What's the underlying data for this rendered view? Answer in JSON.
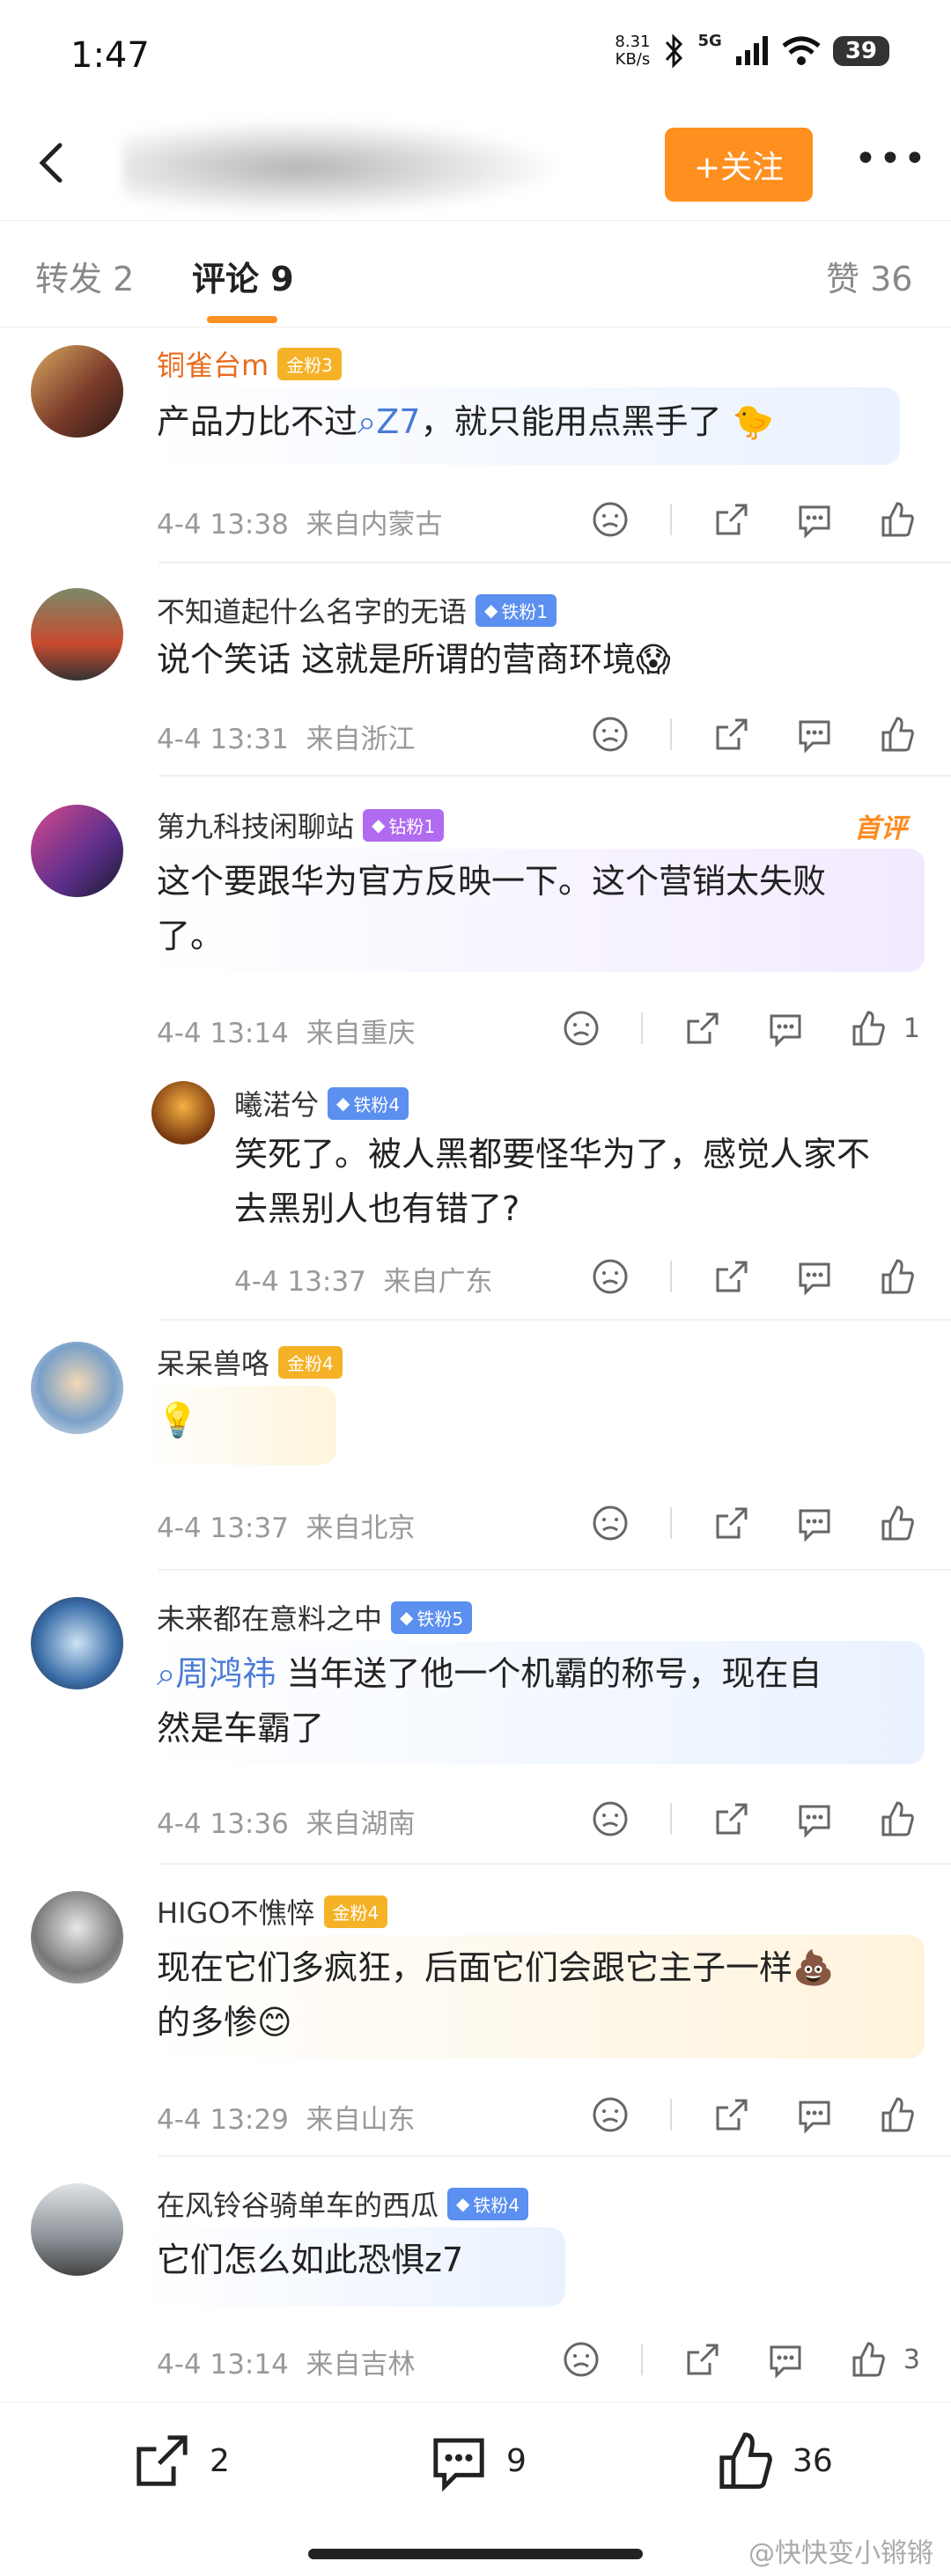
{
  "status_bar": {
    "time": "1:47",
    "net_speed_value": "8.31",
    "net_speed_unit": "KB/s",
    "network": "5G",
    "battery": "39"
  },
  "nav": {
    "follow_label": "+关注"
  },
  "tabs": {
    "repost": "转发 2",
    "comment": "评论 9",
    "like": "赞 36"
  },
  "comments": [
    {
      "name": "铜雀台m",
      "badge": "金粉3",
      "text_pre": "产品力比不过",
      "mention": "Z7",
      "text_post": "，就只能用点黑手了",
      "time": "4-4 13:38",
      "loc": "来自内蒙古"
    },
    {
      "name": "不知道起什么名字的无语",
      "badge": "铁粉1",
      "text": "说个笑话 这就是所谓的营商环境",
      "time": "4-4 13:31",
      "loc": "来自浙江"
    },
    {
      "name": "第九科技闲聊站",
      "badge": "钻粉1",
      "tag": "首评",
      "text1": "这个要跟华为官方反映一下。这个营销太失败",
      "text2": "了。",
      "time": "4-4 13:14",
      "loc": "来自重庆",
      "likes": "1"
    },
    {
      "name": "曦渃兮",
      "badge": "铁粉4",
      "text1": "笑死了。被人黑都要怪华为了，感觉人家不",
      "text2": "去黑别人也有错了?",
      "time": "4-4 13:37",
      "loc": "来自广东"
    },
    {
      "name": "呆呆兽咯",
      "badge": "金粉4",
      "time": "4-4 13:37",
      "loc": "来自北京"
    },
    {
      "name": "未来都在意料之中",
      "badge": "铁粉5",
      "mention": "周鸿祎",
      "text1_post": " 当年送了他一个机霸的称号，现在自",
      "text2": "然是车霸了",
      "time": "4-4 13:36",
      "loc": "来自湖南"
    },
    {
      "name": "HIGO不憔悴",
      "badge": "金粉4",
      "text1": "现在它们多疯狂，后面它们会跟它主子一样",
      "text2": "的多惨",
      "time": "4-4 13:29",
      "loc": "来自山东"
    },
    {
      "name": "在风铃谷骑单车的西瓜",
      "badge": "铁粉4",
      "text": "它们怎么如此恐惧z7",
      "time": "4-4 13:14",
      "loc": "来自吉林",
      "likes": "3"
    }
  ],
  "bottom_bar": {
    "repost_count": "2",
    "comment_count": "9",
    "like_count": "36"
  },
  "watermark": "@快快变小锵锵"
}
